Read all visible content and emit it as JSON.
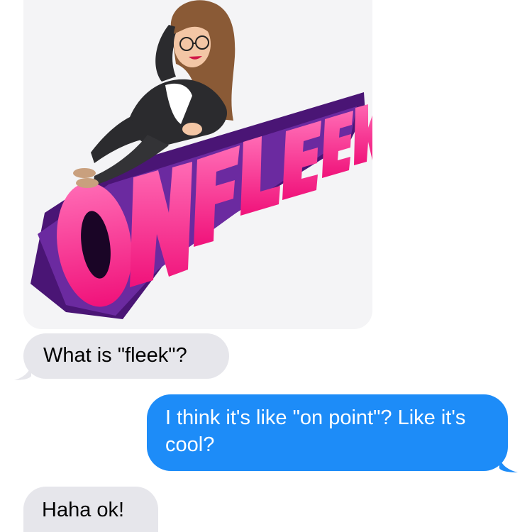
{
  "sticker": {
    "name": "bitmoji-sticker",
    "lettering": "ON FLEEK",
    "colors": {
      "pink": "#ff2d8f",
      "purple": "#5b1a8c",
      "card": "#f4f4f6"
    }
  },
  "messages": [
    {
      "direction": "received",
      "text": "What is \"fleek\"?"
    },
    {
      "direction": "sent",
      "text": "I think it's like \"on point\"? Like it's cool?"
    },
    {
      "direction": "received",
      "text": "Haha ok!"
    }
  ],
  "colors": {
    "received_bubble": "#e6e6eb",
    "sent_bubble": "#1d8cf8",
    "sent_text": "#ffffff"
  }
}
